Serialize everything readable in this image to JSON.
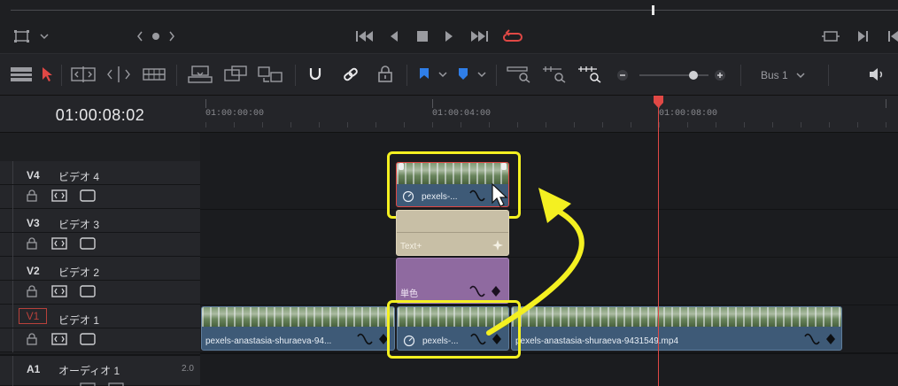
{
  "timeline": {
    "timecode": "01:00:08:02",
    "ruler": {
      "labels": [
        "01:00:00:00",
        "01:00:04:00",
        "01:00:08:00"
      ]
    },
    "bus_label": "Bus 1"
  },
  "tracks": [
    {
      "id": "V4",
      "name": "ビデオ 4"
    },
    {
      "id": "V3",
      "name": "ビデオ 3"
    },
    {
      "id": "V2",
      "name": "ビデオ 2"
    },
    {
      "id": "V1",
      "name": "ビデオ 1"
    },
    {
      "id": "A1",
      "name": "オーディオ 1",
      "channel": "2.0"
    }
  ],
  "clips": {
    "v4_clip": "pexels-...",
    "v3_title": "Text+",
    "v2_solid": "単色",
    "v1_left": "pexels-anastasia-shuraeva-94...",
    "v1_mid": "pexels-...",
    "v1_right": "pexels-anastasia-shuraeva-9431549.mp4"
  },
  "colors": {
    "accent_red": "#e04845",
    "highlight_yellow": "#f4f021",
    "clip_blue": "#3e5a77",
    "title_beige": "#c8bfa6",
    "solid_purple": "#8f6aa0"
  }
}
